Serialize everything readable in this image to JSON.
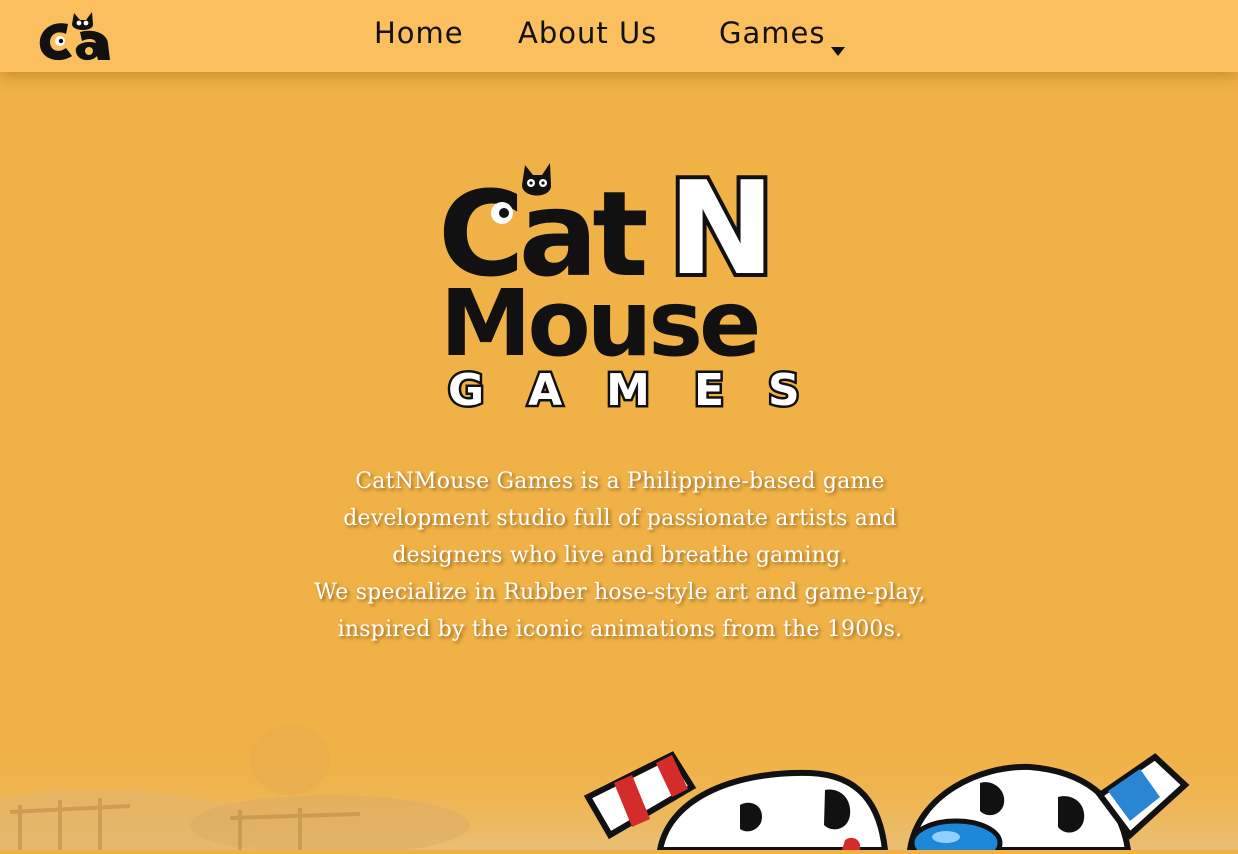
{
  "nav": {
    "logo_alt": "Ca",
    "home_label": "Home",
    "about_label": "About Us",
    "games_label": "Games",
    "games_dropdown_icon": "caret-down-icon"
  },
  "hero": {
    "logo_line1a": "Cat",
    "logo_line1b": "N",
    "logo_line2": "Mouse",
    "logo_line3": "GAMES"
  },
  "about": {
    "paragraph1": "CatNMouse Games is a Philippine-based game development studio full of passionate artists and designers who live and breathe gaming.",
    "paragraph2": "We specialize in Rubber hose-style art and game-play, inspired by the iconic animations from the 1900s."
  },
  "colors": {
    "background": "#f0b246",
    "navbar": "#fbbf5e",
    "text": "#ffffff",
    "nav_text": "#111111"
  }
}
